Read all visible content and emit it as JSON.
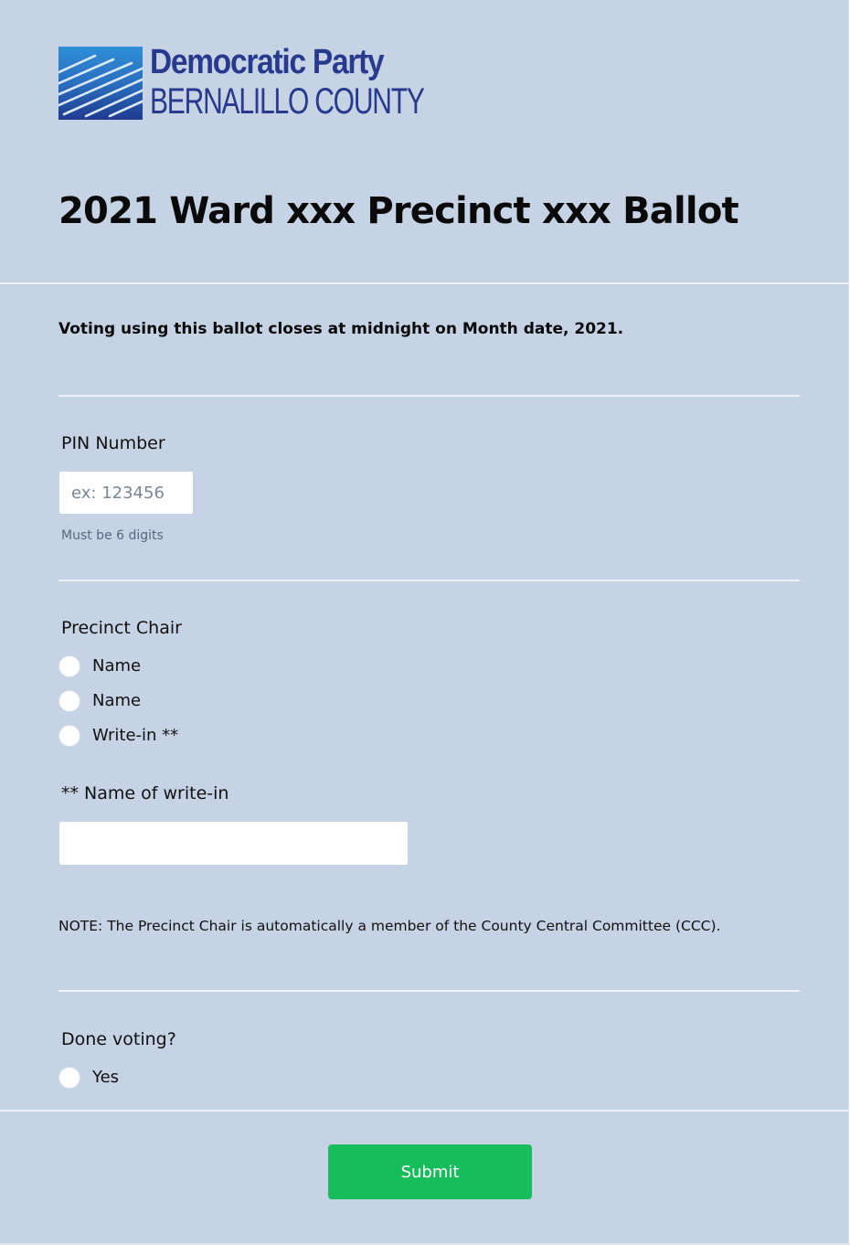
{
  "header": {
    "logo": {
      "line1": "Democratic Party",
      "line2": "BERNALILLO COUNTY",
      "colors": {
        "text": "#273a8e",
        "mark_dark": "#1f3b8f",
        "mark_light": "#2f8fd6"
      }
    },
    "title": "2021 Ward xxx Precinct xxx Ballot"
  },
  "intro": {
    "closes_text": "Voting using this ballot closes at midnight on Month date, 2021."
  },
  "pin": {
    "label": "PIN Number",
    "placeholder": "ex: 123456",
    "value": "",
    "hint": "Must be 6 digits"
  },
  "precinct_chair": {
    "label": "Precinct Chair",
    "options": [
      {
        "label": "Name",
        "selected": false
      },
      {
        "label": "Name",
        "selected": false
      },
      {
        "label": "Write-in **",
        "selected": false
      }
    ]
  },
  "write_in": {
    "label": "** Name of write-in",
    "value": ""
  },
  "note": {
    "text": "NOTE: The Precinct Chair is automatically a member of the County Central Committee (CCC)."
  },
  "done_voting": {
    "label": "Done voting?",
    "options": [
      {
        "label": "Yes",
        "selected": false
      }
    ]
  },
  "submit": {
    "label": "Submit",
    "color": "#18bd5b"
  },
  "theme": {
    "background": "#c6d3e5"
  }
}
